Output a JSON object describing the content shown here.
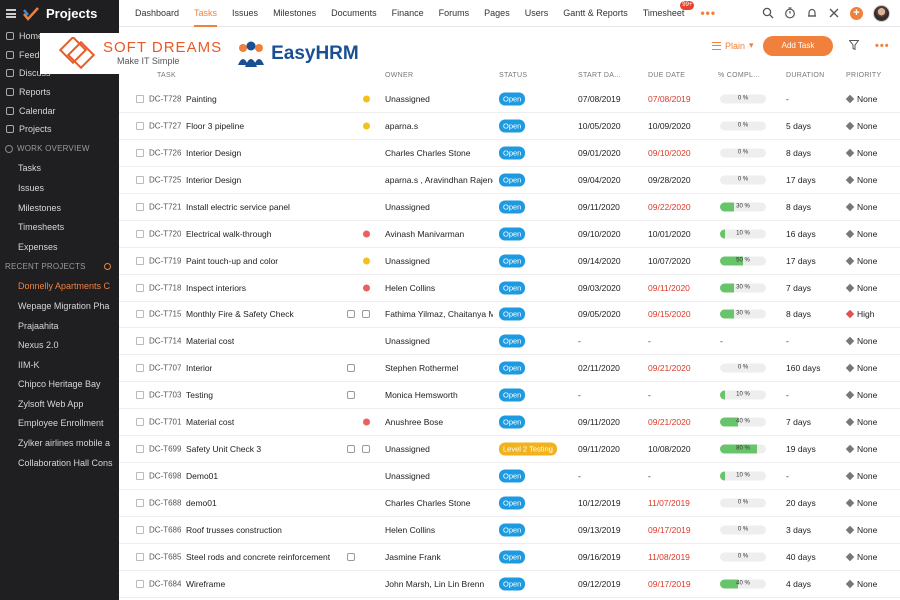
{
  "app": {
    "title": "Projects"
  },
  "sidebar": {
    "menu": [
      {
        "label": "Home",
        "icon": "home-icon"
      },
      {
        "label": "Feed",
        "icon": "feed-icon"
      },
      {
        "label": "Discuss",
        "icon": "discuss-icon"
      },
      {
        "label": "Reports",
        "icon": "reports-icon"
      },
      {
        "label": "Calendar",
        "icon": "calendar-icon"
      },
      {
        "label": "Projects",
        "icon": "projects-icon"
      }
    ],
    "work_overview_label": "WORK OVERVIEW",
    "work_items": [
      {
        "label": "Tasks"
      },
      {
        "label": "Issues"
      },
      {
        "label": "Milestones"
      },
      {
        "label": "Timesheets"
      },
      {
        "label": "Expenses"
      }
    ],
    "recent_label": "RECENT PROJECTS",
    "projects": [
      {
        "label": "Donnelly Apartments C",
        "active": true
      },
      {
        "label": "Wepage Migration Pha"
      },
      {
        "label": "Prajaahita"
      },
      {
        "label": "Nexus 2.0"
      },
      {
        "label": "IIM-K"
      },
      {
        "label": "Chipco Heritage Bay"
      },
      {
        "label": "Zylsoft Web App"
      },
      {
        "label": "Employee Enrollment"
      },
      {
        "label": "Zylker airlines mobile a"
      },
      {
        "label": "Collaboration Hall Cons"
      }
    ]
  },
  "topnav": {
    "items": [
      "Dashboard",
      "Tasks",
      "Issues",
      "Milestones",
      "Documents",
      "Finance",
      "Forums",
      "Pages",
      "Users",
      "Gantt & Reports",
      "Timesheet"
    ],
    "active": "Tasks",
    "timesheet_badge": "99+",
    "more": "•••"
  },
  "brand": {
    "softdreams_name": "SOFT DREAMS",
    "softdreams_tagline": "Make IT Simple",
    "easyhrm_name": "EasyHRM"
  },
  "toolbar": {
    "view_label": "Plain",
    "add_task_label": "Add Task",
    "more": "•••"
  },
  "table": {
    "headers": {
      "task": "TASK",
      "owner": "OWNER",
      "status": "STATUS",
      "start": "START DA...",
      "due": "DUE DATE",
      "completion": "% COMPL...",
      "duration": "DURATION",
      "priority": "PRIORITY"
    },
    "rows": [
      {
        "id": "DC-T728",
        "name": "Painting",
        "marker": "yellow",
        "owner": "Unassigned",
        "status": "Open",
        "start": "07/08/2019",
        "due": "07/08/2019",
        "overdue": true,
        "completion": 0,
        "completion_label": "0 %",
        "duration": "-",
        "priority": "None"
      },
      {
        "id": "DC-T727",
        "name": "Floor 3 pipeline",
        "marker": "yellow",
        "owner": "aparna.s",
        "status": "Open",
        "start": "10/05/2020",
        "due": "10/09/2020",
        "overdue": false,
        "completion": 0,
        "completion_label": "0 %",
        "duration": "5 days",
        "priority": "None"
      },
      {
        "id": "DC-T726",
        "name": "Interior Design",
        "marker": "",
        "owner": "Charles Charles Stone",
        "status": "Open",
        "start": "09/01/2020",
        "due": "09/10/2020",
        "overdue": true,
        "completion": 0,
        "completion_label": "0 %",
        "duration": "8 days",
        "priority": "None"
      },
      {
        "id": "DC-T725",
        "name": "Interior Design",
        "marker": "",
        "owner": "aparna.s , Aravindhan Rajendi",
        "status": "Open",
        "start": "09/04/2020",
        "due": "09/28/2020",
        "overdue": false,
        "completion": 0,
        "completion_label": "0 %",
        "duration": "17 days",
        "priority": "None"
      },
      {
        "id": "DC-T721",
        "name": "Install electric service panel",
        "marker": "",
        "owner": "Unassigned",
        "status": "Open",
        "start": "09/11/2020",
        "due": "09/22/2020",
        "overdue": true,
        "completion": 30,
        "completion_label": "30 %",
        "duration": "8 days",
        "priority": "None"
      },
      {
        "id": "DC-T720",
        "name": "Electrical walk-through",
        "marker": "red",
        "owner": "Avinash Manivarman",
        "status": "Open",
        "start": "09/10/2020",
        "due": "10/01/2020",
        "overdue": false,
        "completion": 10,
        "completion_label": "10 %",
        "duration": "16 days",
        "priority": "None"
      },
      {
        "id": "DC-T719",
        "name": "Paint touch-up and color",
        "marker": "yellow",
        "owner": "Unassigned",
        "status": "Open",
        "start": "09/14/2020",
        "due": "10/07/2020",
        "overdue": false,
        "completion": 50,
        "completion_label": "50 %",
        "duration": "17 days",
        "priority": "None"
      },
      {
        "id": "DC-T718",
        "name": "Inspect interiors",
        "marker": "red",
        "owner": "Helen Collins",
        "status": "Open",
        "start": "09/03/2020",
        "due": "09/11/2020",
        "overdue": true,
        "completion": 30,
        "completion_label": "30 %",
        "duration": "7 days",
        "priority": "None"
      },
      {
        "id": "DC-T715",
        "name": "Monthly Fire & Safety Check",
        "marker": "icons",
        "owner": "Fathima Yilmaz, Chaitanya Me",
        "status": "Open",
        "start": "09/05/2020",
        "due": "09/15/2020",
        "overdue": true,
        "completion": 30,
        "completion_label": "30 %",
        "duration": "8 days",
        "priority": "High"
      },
      {
        "id": "DC-T714",
        "name": "Material cost",
        "marker": "",
        "owner": "Unassigned",
        "status": "Open",
        "start": "-",
        "due": "-",
        "overdue": false,
        "completion": null,
        "completion_label": "-",
        "duration": "-",
        "priority": "None"
      },
      {
        "id": "DC-T707",
        "name": "Interior",
        "marker": "doc",
        "owner": "Stephen Rothermel",
        "status": "Open",
        "start": "02/11/2020",
        "due": "09/21/2020",
        "overdue": true,
        "completion": 0,
        "completion_label": "0 %",
        "duration": "160 days",
        "priority": "None"
      },
      {
        "id": "DC-T703",
        "name": "Testing",
        "marker": "clock",
        "owner": "Monica Hemsworth",
        "status": "Open",
        "start": "-",
        "due": "-",
        "overdue": false,
        "completion": 10,
        "completion_label": "10 %",
        "duration": "-",
        "priority": "None"
      },
      {
        "id": "DC-T701",
        "name": "Material cost",
        "marker": "red",
        "owner": "Anushree Bose",
        "status": "Open",
        "start": "09/11/2020",
        "due": "09/21/2020",
        "overdue": true,
        "completion": 40,
        "completion_label": "40 %",
        "duration": "7 days",
        "priority": "None"
      },
      {
        "id": "DC-T699",
        "name": "Safety Unit Check 3",
        "marker": "icons",
        "owner": "Unassigned",
        "status": "Level 2 Testing",
        "start": "09/11/2020",
        "due": "10/08/2020",
        "overdue": false,
        "completion": 80,
        "completion_label": "80 %",
        "duration": "19 days",
        "priority": "None"
      },
      {
        "id": "DC-T698",
        "name": "Demo01",
        "marker": "",
        "owner": "Unassigned",
        "status": "Open",
        "start": "-",
        "due": "-",
        "overdue": false,
        "completion": 10,
        "completion_label": "10 %",
        "duration": "-",
        "priority": "None"
      },
      {
        "id": "DC-T688",
        "name": "demo01",
        "marker": "",
        "owner": "Charles Charles Stone",
        "status": "Open",
        "start": "10/12/2019",
        "due": "11/07/2019",
        "overdue": true,
        "completion": 0,
        "completion_label": "0 %",
        "duration": "20 days",
        "priority": "None"
      },
      {
        "id": "DC-T686",
        "name": "Roof trusses construction",
        "marker": "",
        "owner": "Helen Collins",
        "status": "Open",
        "start": "09/13/2019",
        "due": "09/17/2019",
        "overdue": true,
        "completion": 0,
        "completion_label": "0 %",
        "duration": "3 days",
        "priority": "None"
      },
      {
        "id": "DC-T685",
        "name": "Steel rods and concrete reinforcement -",
        "marker": "people",
        "owner": "Jasmine Frank",
        "status": "Open",
        "start": "09/16/2019",
        "due": "11/08/2019",
        "overdue": true,
        "completion": 0,
        "completion_label": "0 %",
        "duration": "40 days",
        "priority": "None"
      },
      {
        "id": "DC-T684",
        "name": "Wireframe",
        "marker": "",
        "owner": "John Marsh, Lin Lin Brenn",
        "status": "Open",
        "start": "09/12/2019",
        "due": "09/17/2019",
        "overdue": true,
        "completion": 40,
        "completion_label": "40 %",
        "duration": "4 days",
        "priority": "None"
      }
    ]
  },
  "colors": {
    "accent": "#f0803c",
    "status_open": "#1e9be0",
    "status_testing": "#f2b21b",
    "overdue": "#d83b2b",
    "progress": "#67c46a",
    "priority_high": "#e05252"
  }
}
